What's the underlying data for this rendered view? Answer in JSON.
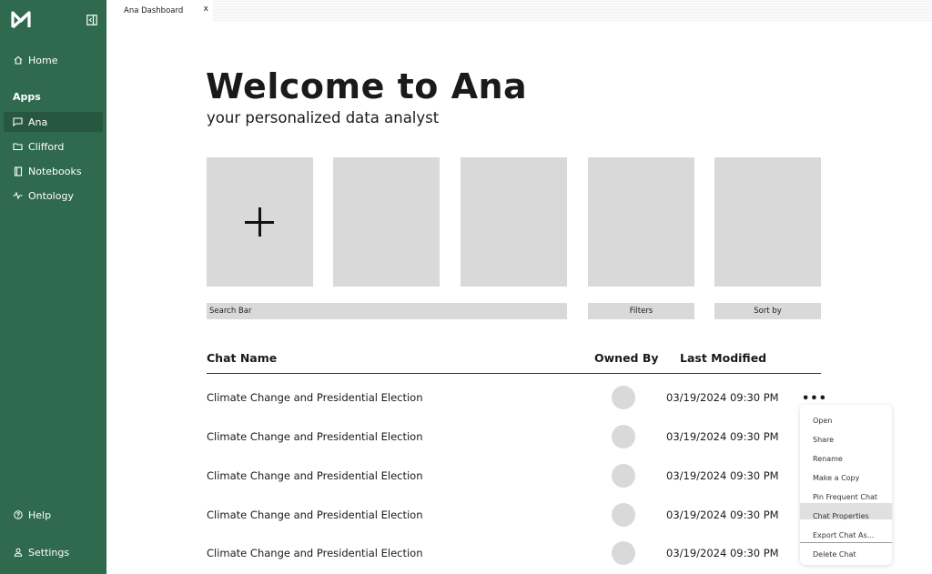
{
  "sidebar": {
    "home_label": "Home",
    "apps_heading": "Apps",
    "apps": [
      {
        "label": "Ana",
        "icon": "chat-icon"
      },
      {
        "label": "Clifford",
        "icon": "folder-icon"
      },
      {
        "label": "Notebooks",
        "icon": "notebook-icon"
      },
      {
        "label": "Ontology",
        "icon": "ontology-icon"
      }
    ],
    "help_label": "Help",
    "settings_label": "Settings"
  },
  "tab": {
    "label": "Ana Dashboard",
    "close": "x"
  },
  "hero": {
    "title": "Welcome to Ana",
    "subtitle": "your personalized data analyst"
  },
  "controls": {
    "search_placeholder": "Search Bar",
    "filters_label": "Filters",
    "sort_label": "Sort by"
  },
  "table": {
    "headers": {
      "name": "Chat Name",
      "owner": "Owned By",
      "modified": "Last Modified"
    },
    "rows": [
      {
        "name": "Climate Change and Presidential Election",
        "modified": "03/19/2024 09:30 PM"
      },
      {
        "name": "Climate Change and Presidential Election",
        "modified": "03/19/2024 09:30 PM"
      },
      {
        "name": "Climate Change and Presidential Election",
        "modified": "03/19/2024 09:30 PM"
      },
      {
        "name": "Climate Change and Presidential Election",
        "modified": "03/19/2024 09:30 PM"
      },
      {
        "name": "Climate Change and Presidential Election",
        "modified": "03/19/2024 09:30 PM"
      }
    ],
    "more_label": "•••"
  },
  "context_menu": {
    "items": [
      "Open",
      "Share",
      "Rename",
      "Make a Copy",
      "Pin Frequent Chat",
      "Chat Properties",
      "Export Chat As...",
      "Delete Chat"
    ],
    "highlighted": "Chat Properties"
  },
  "colors": {
    "sidebar": "#2f6a4f",
    "sidebar_active": "#27583f",
    "placeholder_gray": "#d9d9d9"
  }
}
